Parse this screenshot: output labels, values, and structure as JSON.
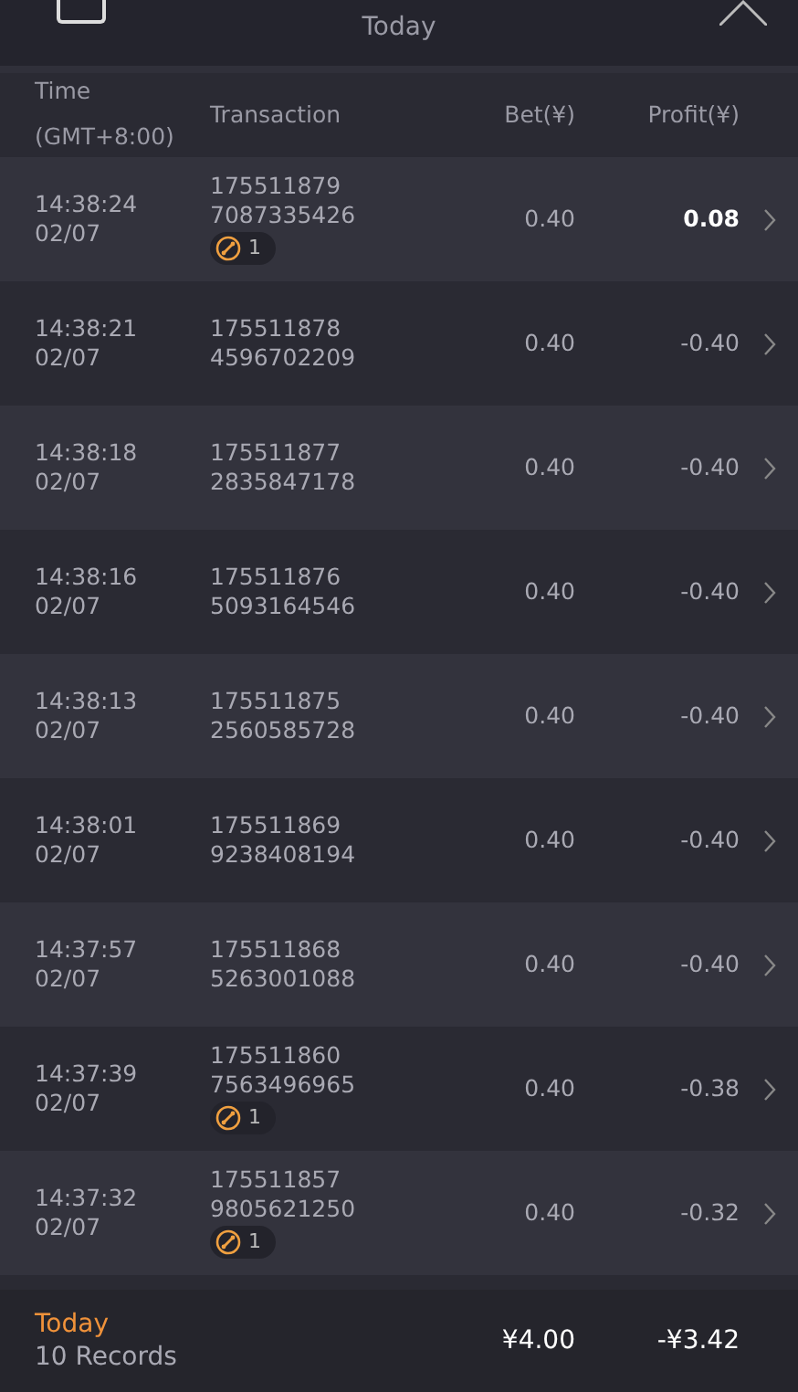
{
  "header": {
    "subtitle": "Today"
  },
  "columns": [
    {
      "label": "Time",
      "sub": "(GMT+8:00)"
    },
    {
      "label": "Transaction"
    },
    {
      "label": "Bet(¥)"
    },
    {
      "label": "Profit(¥)"
    }
  ],
  "rows": [
    {
      "time": "14:38:24",
      "date": "02/07",
      "tx1": "175511879",
      "tx2": "7087335426",
      "badge": "1",
      "bet": "0.40",
      "profit": "0.08",
      "win": true
    },
    {
      "time": "14:38:21",
      "date": "02/07",
      "tx1": "175511878",
      "tx2": "4596702209",
      "bet": "0.40",
      "profit": "-0.40",
      "win": false
    },
    {
      "time": "14:38:18",
      "date": "02/07",
      "tx1": "175511877",
      "tx2": "2835847178",
      "bet": "0.40",
      "profit": "-0.40",
      "win": false
    },
    {
      "time": "14:38:16",
      "date": "02/07",
      "tx1": "175511876",
      "tx2": "5093164546",
      "bet": "0.40",
      "profit": "-0.40",
      "win": false
    },
    {
      "time": "14:38:13",
      "date": "02/07",
      "tx1": "175511875",
      "tx2": "2560585728",
      "bet": "0.40",
      "profit": "-0.40",
      "win": false
    },
    {
      "time": "14:38:01",
      "date": "02/07",
      "tx1": "175511869",
      "tx2": "9238408194",
      "bet": "0.40",
      "profit": "-0.40",
      "win": false
    },
    {
      "time": "14:37:57",
      "date": "02/07",
      "tx1": "175511868",
      "tx2": "5263001088",
      "bet": "0.40",
      "profit": "-0.40",
      "win": false
    },
    {
      "time": "14:37:39",
      "date": "02/07",
      "tx1": "175511860",
      "tx2": "7563496965",
      "badge": "1",
      "bet": "0.40",
      "profit": "-0.38",
      "win": false
    },
    {
      "time": "14:37:32",
      "date": "02/07",
      "tx1": "175511857",
      "tx2": "9805621250",
      "badge": "1",
      "bet": "0.40",
      "profit": "-0.32",
      "win": false
    }
  ],
  "footer": {
    "period": "Today",
    "count": "10 Records",
    "bet_total": "¥4.00",
    "profit_total": "-¥3.42"
  }
}
